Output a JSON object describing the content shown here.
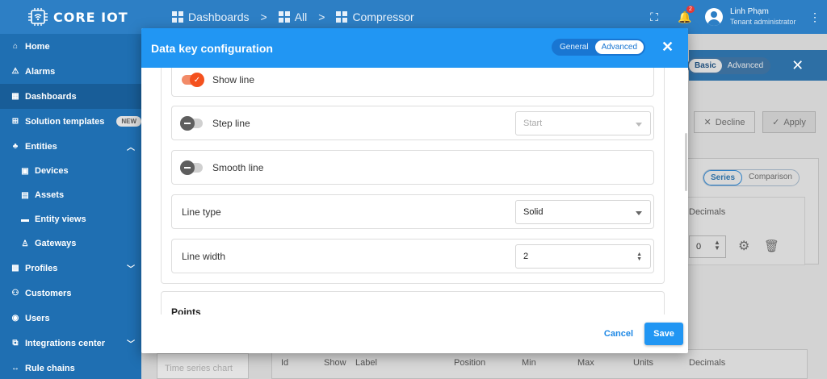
{
  "topbar": {
    "logo": "CORE IOT",
    "breadcrumb": [
      {
        "label": "Dashboards"
      },
      {
        "label": "All"
      },
      {
        "label": "Compressor"
      }
    ],
    "separator": ">",
    "notification_count": "2",
    "user_name": "Linh Phạm",
    "user_role": "Tenant administrator"
  },
  "sidebar": {
    "items": [
      {
        "label": "Home",
        "icon": "home-icon"
      },
      {
        "label": "Alarms",
        "icon": "warning-icon"
      },
      {
        "label": "Dashboards",
        "icon": "dashboard-icon"
      },
      {
        "label": "Solution templates",
        "icon": "apps-icon",
        "badge": "NEW"
      },
      {
        "label": "Entities",
        "icon": "entities-icon"
      },
      {
        "label": "Devices",
        "icon": "device-icon"
      },
      {
        "label": "Assets",
        "icon": "asset-icon"
      },
      {
        "label": "Entity views",
        "icon": "view-icon"
      },
      {
        "label": "Gateways",
        "icon": "gateway-icon"
      },
      {
        "label": "Profiles",
        "icon": "profile-icon"
      },
      {
        "label": "Customers",
        "icon": "customers-icon"
      },
      {
        "label": "Users",
        "icon": "user-icon"
      },
      {
        "label": "Integrations center",
        "icon": "integration-icon"
      },
      {
        "label": "Rule chains",
        "icon": "rule-chain-icon"
      }
    ]
  },
  "background": {
    "mode_basic": "Basic",
    "mode_advanced": "Advanced",
    "decline": "Decline",
    "apply": "Apply",
    "tab_series": "Series",
    "tab_comparison": "Comparison",
    "decimals_header": "Decimals",
    "decimals_value": "0",
    "widget_label": "Time series chart",
    "table_headers": [
      "Id",
      "Show",
      "Label",
      "Position",
      "Min",
      "Max",
      "Units",
      "Decimals"
    ]
  },
  "modal": {
    "title": "Data key configuration",
    "mode_general": "General",
    "mode_advanced": "Advanced",
    "show_line": "Show line",
    "step_line": "Step line",
    "step_line_value": "Start",
    "smooth_line": "Smooth line",
    "line_type": "Line type",
    "line_type_value": "Solid",
    "line_width": "Line width",
    "line_width_value": "2",
    "points": "Points",
    "cancel": "Cancel",
    "save": "Save"
  }
}
